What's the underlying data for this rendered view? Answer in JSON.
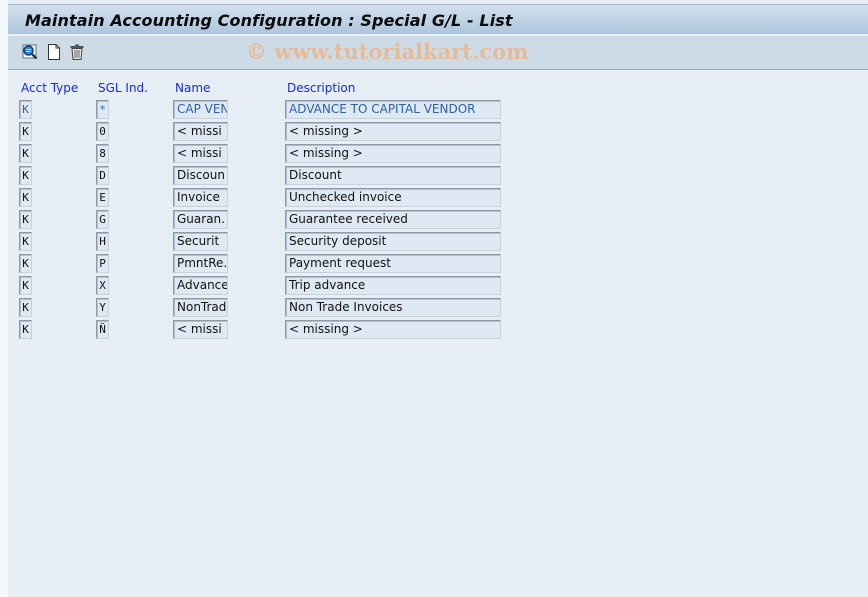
{
  "window": {
    "title": "Maintain Accounting Configuration : Special G/L - List"
  },
  "toolbar": {
    "buttons": [
      {
        "name": "details",
        "icon": "magnifier-details-icon",
        "tooltip": "Details"
      },
      {
        "name": "create",
        "icon": "new-document-icon",
        "tooltip": "Create"
      },
      {
        "name": "delete",
        "icon": "trash-icon",
        "tooltip": "Delete"
      }
    ],
    "watermark": "© www.tutorialkart.com"
  },
  "table": {
    "columns": [
      "Acct Type",
      "SGL Ind.",
      "Name",
      "Description"
    ],
    "rows": [
      {
        "acct_type": "K",
        "sgl_ind": "*",
        "name": "CAP VEN",
        "description": "ADVANCE TO CAPITAL VENDOR",
        "selected": true
      },
      {
        "acct_type": "K",
        "sgl_ind": "0",
        "name": "< missi",
        "description": "< missing >"
      },
      {
        "acct_type": "K",
        "sgl_ind": "8",
        "name": "< missi",
        "description": "< missing >"
      },
      {
        "acct_type": "K",
        "sgl_ind": "D",
        "name": "Discoun",
        "description": "Discount"
      },
      {
        "acct_type": "K",
        "sgl_ind": "E",
        "name": "Invoice",
        "description": "Unchecked invoice"
      },
      {
        "acct_type": "K",
        "sgl_ind": "G",
        "name": "Guaran.",
        "description": "Guarantee received"
      },
      {
        "acct_type": "K",
        "sgl_ind": "H",
        "name": "Securit",
        "description": "Security deposit"
      },
      {
        "acct_type": "K",
        "sgl_ind": "P",
        "name": "PmntRe…",
        "description": "Payment request"
      },
      {
        "acct_type": "K",
        "sgl_ind": "X",
        "name": "Advance",
        "description": "Trip advance"
      },
      {
        "acct_type": "K",
        "sgl_ind": "Y",
        "name": "NonTrad",
        "description": "Non Trade Invoices"
      },
      {
        "acct_type": "K",
        "sgl_ind": "Ñ",
        "name": "< missi",
        "description": "< missing >"
      }
    ]
  },
  "colors": {
    "header_text": "#1a2bd0",
    "selected_text": "#2a62a8",
    "watermark": "#e9b890"
  }
}
